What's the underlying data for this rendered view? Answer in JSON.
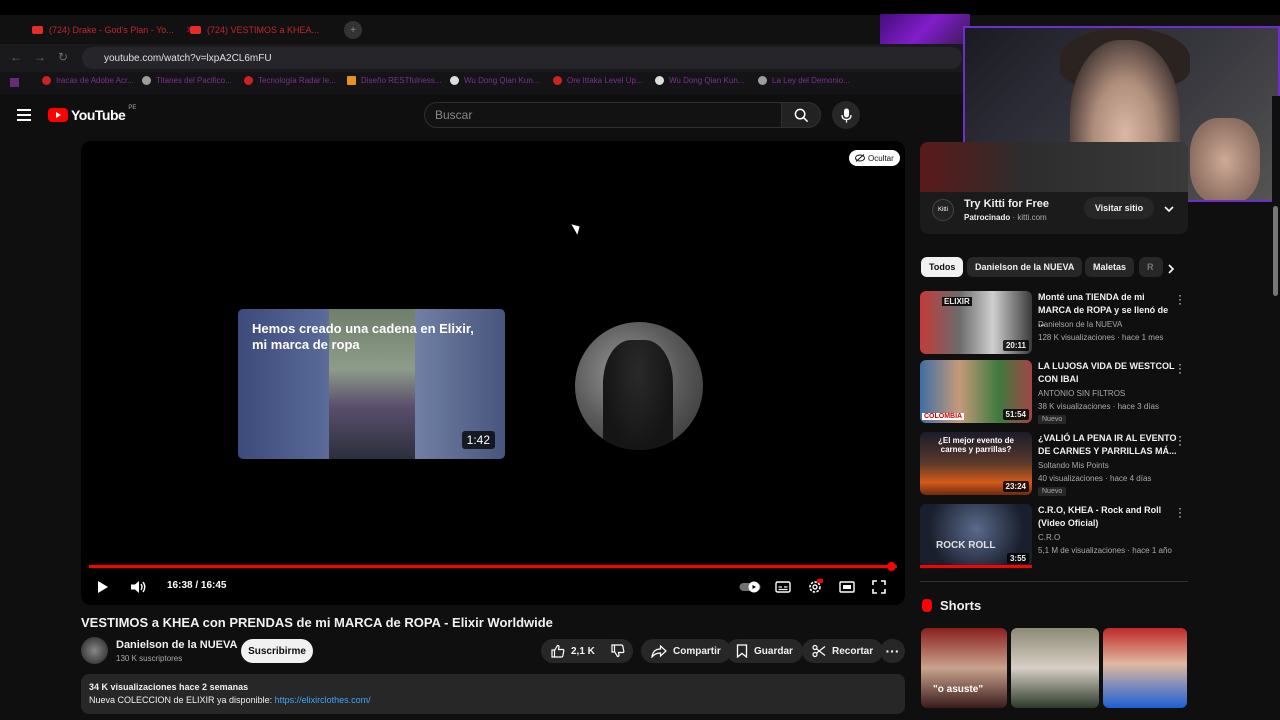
{
  "browser": {
    "tabs": [
      {
        "label": "(724) Drake - God's Plan - Yo..."
      },
      {
        "label": "(724) VESTIMOS a KHEA..."
      }
    ],
    "url": "youtube.com/watch?v=lxpA2CL6mFU",
    "bookmarks": [
      "Iracas de Adobe Acr...",
      "Titanes del Pacifico...",
      "Tecnología Radar le...",
      "Diseño RESTfulness...",
      "Wu Dong Qian Kun...",
      "Ore Ittaka Level Up...",
      "Wu Dong Qian Kun...",
      "La Ley del Demonio..."
    ]
  },
  "header": {
    "logo_word": "YouTube",
    "region": "PE",
    "search_placeholder": "Buscar",
    "icons": [
      "menu-icon",
      "search-icon",
      "mic-icon"
    ]
  },
  "player": {
    "hide_label": "Ocultar",
    "endcard_title": "Hemos creado una cadena en Elixir, mi marca de ropa",
    "endcard_duration": "1:42",
    "time": "16:38 / 16:45",
    "progress": 0.993
  },
  "video": {
    "title": "VESTIMOS a KHEA con PRENDAS de mi MARCA de ROPA - Elixir Worldwide",
    "channel": "Danielson de la NUEVA",
    "subscribers": "130 K suscriptores",
    "subscribe_label": "Suscribirme",
    "likes": "2,1 K",
    "share_label": "Compartir",
    "save_label": "Guardar",
    "clip_label": "Recortar",
    "desc_meta": "34 K visualizaciones  hace 2 semanas",
    "desc_line": "Nueva COLECCION de ELIXIR ya disponible: ",
    "desc_link": "https://elixirclothes.com/"
  },
  "ad": {
    "title": "Try Kitti for Free",
    "sponsor": "Patrocinado",
    "domain": "kitti.com",
    "visit_label": "Visitar sitio",
    "logo_text": "Kitti"
  },
  "chips": [
    "Todos",
    "Danielson de la NUEVA",
    "Maletas",
    "R"
  ],
  "recommendations": [
    {
      "title": "Monté una TIENDA de mi MARCA de ROPA y se llenó de ...",
      "channel": "Danielson de la NUEVA",
      "views": "128 K visualizaciones · hace 1 mes",
      "duration": "20:11",
      "badge": ""
    },
    {
      "title": "LA LUJOSA VIDA DE WESTCOL CON IBAI",
      "channel": "ANTONIO SIN FILTROS",
      "views": "38 K visualizaciones · hace 3 días",
      "duration": "51:54",
      "badge": "Nuevo"
    },
    {
      "title": "¿VALIÓ LA PENA IR AL EVENTO DE CARNES Y PARRILLAS MÁ...",
      "channel": "Soltando Mis Points",
      "views": "40 visualizaciones · hace 4 días",
      "duration": "23:24",
      "badge": "Nuevo"
    },
    {
      "title": "C.R.O, KHEA - Rock and Roll (Video Oficial)",
      "channel": "C.R.O",
      "views": "5,1 M de visualizaciones · hace 1 año",
      "duration": "3:55",
      "badge": ""
    }
  ],
  "thumb_texts": [
    "ELIXIR",
    "COLOMBIA",
    "¿El mejor evento de carnes y parrillas?",
    "ROCK ROLL"
  ],
  "shorts": {
    "heading": "Shorts",
    "first_caption": "\"o asuste\""
  }
}
